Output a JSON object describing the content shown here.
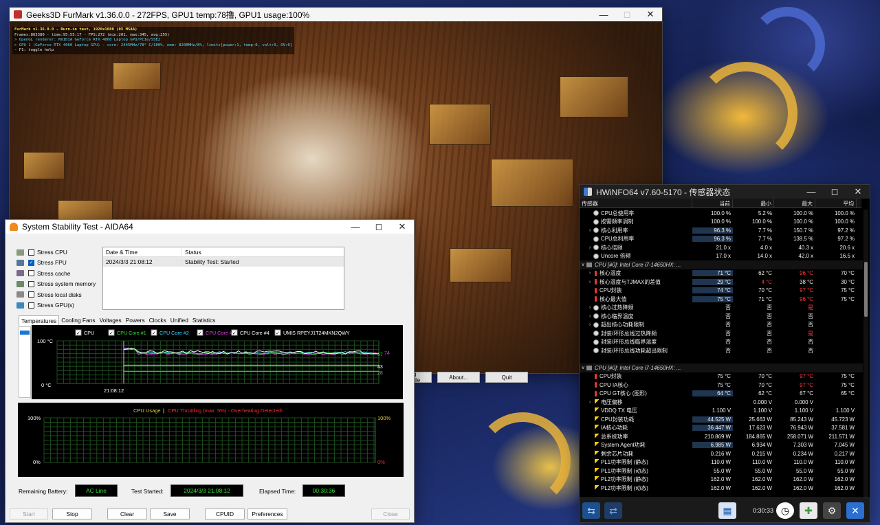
{
  "furmark": {
    "title": "Geeks3D FurMark v1.36.0.0 - 272FPS, GPU1 temp:78撸, GPU1 usage:100%",
    "osd": [
      {
        "text": "FurMark v1.36.0.0 - Burn-in test, 1920x1080 (0X MSAA)",
        "color": "y"
      },
      {
        "text": "Frames:863380 - time:95:55:17 - FPS:272 (min:201, max:345, avg:255)",
        "color": "w"
      },
      {
        "text": "> OpenGL renderer: NVIDIA GeForce RTX 4060 Laptop GPU/PCIe/SSE2",
        "color": "c"
      },
      {
        "text": "> GPU 1 (GeForce RTX 4060 Laptop GPU) - core: 2445MHz/78° C/100%, mem: 8200MHz/8%, limits[power:1, temp:0, volt:0, OV:0]",
        "color": "c"
      },
      {
        "text": "- F1: toggle help",
        "color": "w"
      }
    ],
    "bottom_buttons": [
      "g file",
      "About...",
      "Quit"
    ]
  },
  "aida": {
    "title": "System Stability Test - AIDA64",
    "stress_options": [
      {
        "label": "Stress CPU",
        "checked": false
      },
      {
        "label": "Stress FPU",
        "checked": true
      },
      {
        "label": "Stress cache",
        "checked": false
      },
      {
        "label": "Stress system memory",
        "checked": false
      },
      {
        "label": "Stress local disks",
        "checked": false
      },
      {
        "label": "Stress GPU(s)",
        "checked": false
      }
    ],
    "status_table": {
      "headers": [
        "Date & Time",
        "Status"
      ],
      "rows": [
        [
          "2024/3/3 21:08:12",
          "Stability Test: Started"
        ]
      ]
    },
    "tabs": [
      "Temperatures",
      "Cooling Fans",
      "Voltages",
      "Powers",
      "Clocks",
      "Unified",
      "Statistics"
    ],
    "temp_chart": {
      "legend": [
        {
          "label": "CPU",
          "color": "#ffffff"
        },
        {
          "label": "CPU Core #1",
          "color": "#33e033"
        },
        {
          "label": "CPU Core #2",
          "color": "#33d7ff"
        },
        {
          "label": "CPU Core #3",
          "color": "#e040e0"
        },
        {
          "label": "CPU Core #4",
          "color": "#ffffff"
        },
        {
          "label": "UMIS RPEYJ1T24MKN2QWY",
          "color": "#ffffff"
        }
      ],
      "y_top": "100 °C",
      "y_bottom": "0 °C",
      "x_label": "21:08:12",
      "right_values": [
        "67",
        "74",
        "43",
        "28"
      ]
    },
    "usage_chart": {
      "title_usage": "CPU Usage",
      "separator": "|",
      "title_throttle": "CPU Throttling (max: 5%) - Overheating Detected!",
      "y_top_left": "100%",
      "y_bottom_left": "0%",
      "y_top_right": "100%",
      "y_bottom_right": "0%"
    },
    "info": {
      "battery_label": "Remaining Battery:",
      "battery_value": "AC Line",
      "started_label": "Test Started:",
      "started_value": "2024/3/3 21:08:12",
      "elapsed_label": "Elapsed Time:",
      "elapsed_value": "00:30:36"
    },
    "buttons": {
      "start": "Start",
      "stop": "Stop",
      "clear": "Clear",
      "save": "Save",
      "cpuid": "CPUID",
      "preferences": "Preferences",
      "close": "Close"
    }
  },
  "hwinfo": {
    "title": "HWiNFO64 v7.60-5170 - 传感器状态",
    "columns": [
      "传感器",
      "当前",
      "最小",
      "最大",
      "平均"
    ],
    "rows": [
      {
        "icon": "clock",
        "name": "CPU总使用率",
        "cur": "100.0 %",
        "min": "5.2 %",
        "max": "100.0 %",
        "avg": "100.0 %"
      },
      {
        "icon": "clock",
        "name": "按需频率调制",
        "cur": "100.0 %",
        "min": "100.0 %",
        "max": "100.0 %",
        "avg": "100.0 %"
      },
      {
        "icon": "clock",
        "arrow": true,
        "name": "核心利用率",
        "cur": "96.3 %",
        "min": "7.7 %",
        "max": "150.7 %",
        "avg": "97.2 %",
        "hl": true
      },
      {
        "icon": "clock",
        "name": "CPU总利用率",
        "cur": "96.3 %",
        "min": "7.7 %",
        "max": "138.5 %",
        "avg": "97.2 %",
        "hl": true
      },
      {
        "icon": "clock",
        "arrow": true,
        "name": "核心倍频",
        "cur": "21.0 x",
        "min": "4.0 x",
        "max": "40.3 x",
        "avg": "20.6 x"
      },
      {
        "icon": "clock",
        "name": "Uncore 倍频",
        "cur": "17.0 x",
        "min": "14.0 x",
        "max": "42.0 x",
        "avg": "16.5 x"
      },
      {
        "group": true,
        "name": "CPU [#0]: Intel Core i7-14650HX: ..."
      },
      {
        "icon": "therm",
        "arrow": true,
        "name": "核心温度",
        "cur": "71 °C",
        "min": "62 °C",
        "max": "96 °C",
        "avg": "70 °C",
        "maxRed": true,
        "hl": true
      },
      {
        "icon": "therm",
        "arrow": true,
        "name": "核心温度与TJMAX的差值",
        "cur": "29 °C",
        "min": "4 °C",
        "max": "38 °C",
        "avg": "30 °C",
        "minRed": true,
        "hl": true
      },
      {
        "icon": "therm",
        "name": "CPU封装",
        "cur": "74 °C",
        "min": "70 °C",
        "max": "97 °C",
        "avg": "75 °C",
        "maxRed": true,
        "hl": true
      },
      {
        "icon": "therm",
        "name": "核心最大值",
        "cur": "75 °C",
        "min": "71 °C",
        "max": "96 °C",
        "avg": "75 °C",
        "maxRed": true,
        "hl": true
      },
      {
        "icon": "clock",
        "arrow": true,
        "name": "核心过热降频",
        "cur": "否",
        "min": "否",
        "max": "是",
        "avg": "",
        "maxRed": true
      },
      {
        "icon": "clock",
        "arrow": true,
        "name": "核心临界温度",
        "cur": "否",
        "min": "否",
        "max": "否",
        "avg": ""
      },
      {
        "icon": "clock",
        "arrow": true,
        "name": "超出核心功耗限制",
        "cur": "否",
        "min": "否",
        "max": "否",
        "avg": ""
      },
      {
        "icon": "clock",
        "name": "封装/环形总线过热降频",
        "cur": "否",
        "min": "否",
        "max": "是",
        "avg": "",
        "maxRed": true
      },
      {
        "icon": "clock",
        "name": "封装/环形总线临界温度",
        "cur": "否",
        "min": "否",
        "max": "否",
        "avg": ""
      },
      {
        "icon": "clock",
        "name": "封装/环形总线功耗超出限制",
        "cur": "否",
        "min": "否",
        "max": "否",
        "avg": ""
      },
      {
        "spacer": true
      },
      {
        "group": true,
        "name": "CPU [#0]: Intel Core i7-14650HX: ..."
      },
      {
        "icon": "therm",
        "name": "CPU封装",
        "cur": "75 °C",
        "min": "70 °C",
        "max": "97 °C",
        "avg": "75 °C",
        "maxRed": true
      },
      {
        "icon": "therm",
        "name": "CPU IA核心",
        "cur": "75 °C",
        "min": "70 °C",
        "max": "97 °C",
        "avg": "75 °C",
        "maxRed": true
      },
      {
        "icon": "therm",
        "name": "CPU GT核心 (图形)",
        "cur": "64 °C",
        "min": "62 °C",
        "max": "67 °C",
        "avg": "65 °C",
        "hl": true
      },
      {
        "icon": "bolt",
        "arrow": true,
        "name": "电压偏移",
        "cur": "",
        "min": "0.000 V",
        "max": "0.000 V",
        "avg": ""
      },
      {
        "icon": "bolt",
        "name": "VDDQ TX 电压",
        "cur": "1.100 V",
        "min": "1.100 V",
        "max": "1.100 V",
        "avg": "1.100 V"
      },
      {
        "icon": "bolt",
        "name": "CPU封装功耗",
        "cur": "44.525 W",
        "min": "25.663 W",
        "max": "85.243 W",
        "avg": "45.723 W",
        "hl": true
      },
      {
        "icon": "bolt",
        "name": "IA核心功耗",
        "cur": "36.447 W",
        "min": "17.623 W",
        "max": "76.943 W",
        "avg": "37.581 W",
        "hl": true
      },
      {
        "icon": "bolt",
        "name": "总系统功率",
        "cur": "210.869 W",
        "min": "184.865 W",
        "max": "258.071 W",
        "avg": "211.571 W"
      },
      {
        "icon": "bolt",
        "name": "System Agent功耗",
        "cur": "6.985 W",
        "min": "6.934 W",
        "max": "7.303 W",
        "avg": "7.045 W",
        "hl": true
      },
      {
        "icon": "bolt",
        "name": "剩余芯片功耗",
        "cur": "0.216 W",
        "min": "0.215 W",
        "max": "0.234 W",
        "avg": "0.217 W"
      },
      {
        "icon": "bolt",
        "name": "PL1功率限制 (静态)",
        "cur": "110.0 W",
        "min": "110.0 W",
        "max": "110.0 W",
        "avg": "110.0 W"
      },
      {
        "icon": "bolt",
        "name": "PL1功率限制 (动态)",
        "cur": "55.0 W",
        "min": "55.0 W",
        "max": "55.0 W",
        "avg": "55.0 W"
      },
      {
        "icon": "bolt",
        "name": "PL2功率限制 (静态)",
        "cur": "162.0 W",
        "min": "162.0 W",
        "max": "162.0 W",
        "avg": "162.0 W"
      },
      {
        "icon": "bolt",
        "name": "PL2功率限制 (动态)",
        "cur": "162.0 W",
        "min": "162.0 W",
        "max": "162.0 W",
        "avg": "162.0 W"
      }
    ],
    "footer_time": "0:30:33"
  }
}
